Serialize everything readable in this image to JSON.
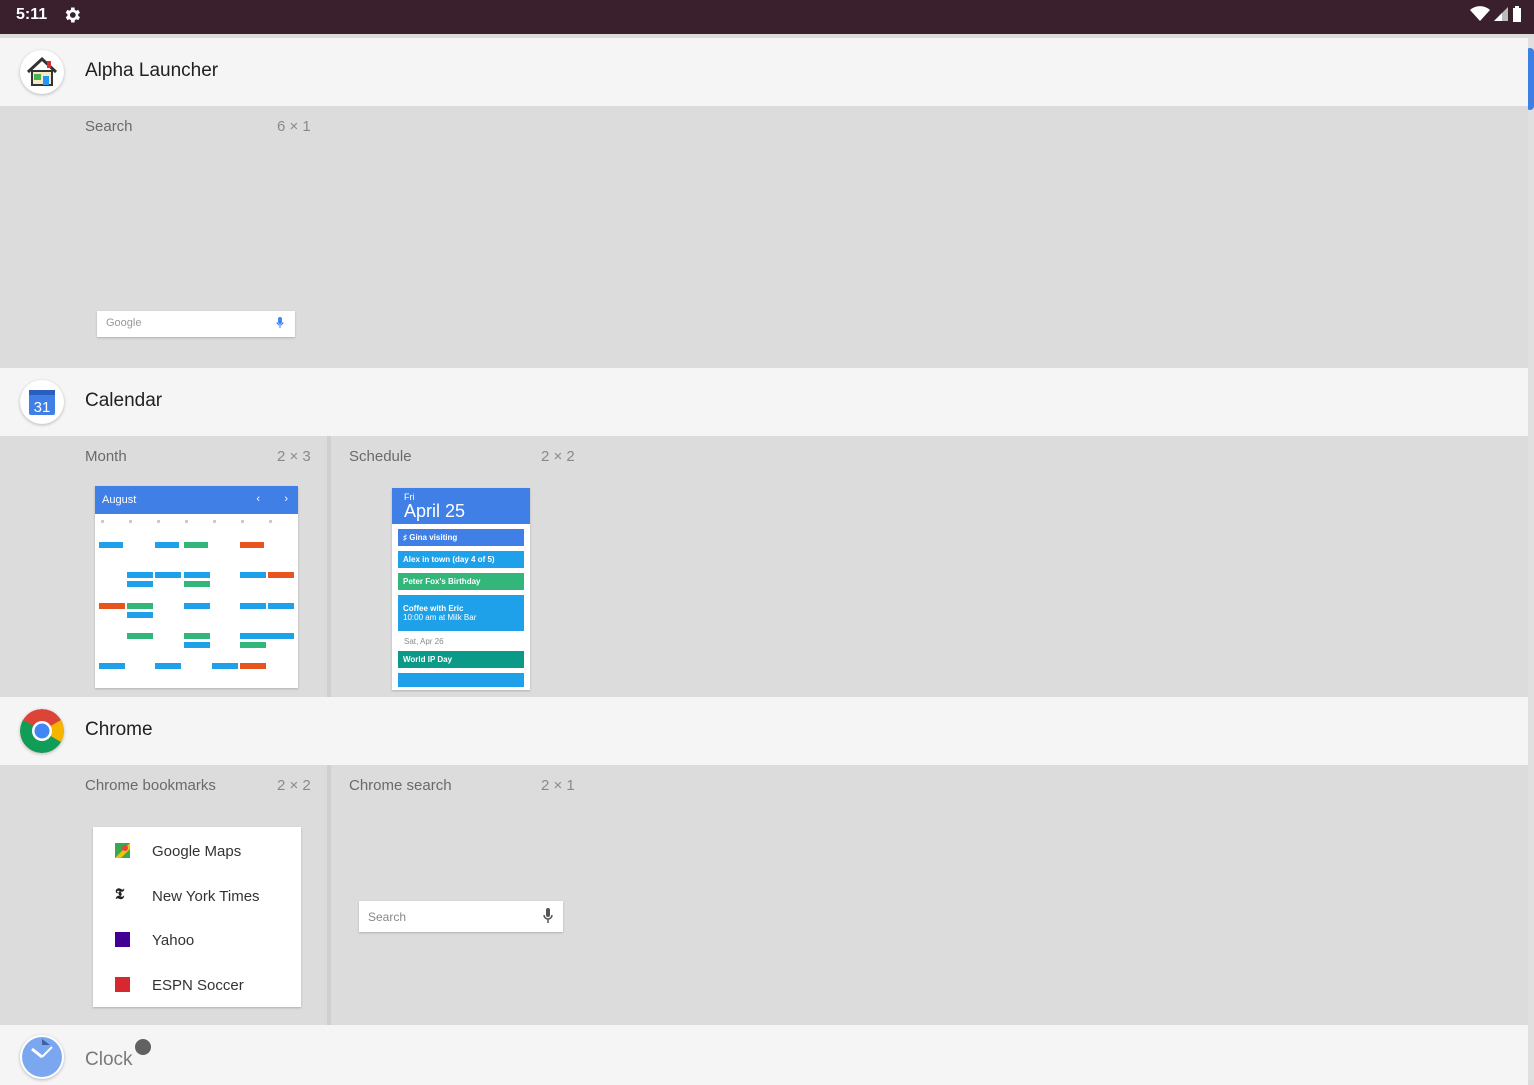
{
  "status_bar": {
    "time": "5:11"
  },
  "apps": [
    {
      "name": "Alpha Launcher",
      "widgets": [
        {
          "label": "Search",
          "size": "6 × 1",
          "preview_logo": "Google"
        }
      ]
    },
    {
      "name": "Calendar",
      "icon_text": "31",
      "widgets": [
        {
          "label": "Month",
          "size": "2 × 3",
          "month": "August"
        },
        {
          "label": "Schedule",
          "size": "2 × 2",
          "day": "Fri",
          "date": "April 25",
          "events": [
            {
              "text": "♯ Gina visiting",
              "color": "#3f7fe6"
            },
            {
              "text": "Alex in town (day 4 of 5)",
              "color": "#1ea1e8"
            },
            {
              "text": "Peter Fox's Birthday",
              "color": "#33b679"
            },
            {
              "text": "Coffee with Eric",
              "text2": "10:00 am at Milk Bar",
              "color": "#1ea1e8"
            }
          ],
          "next_day": "Sat, Apr 26",
          "next_events": [
            {
              "text": "World IP Day",
              "color": "#0b9a87"
            }
          ]
        }
      ]
    },
    {
      "name": "Chrome",
      "widgets": [
        {
          "label": "Chrome bookmarks",
          "size": "2 × 2",
          "bookmarks": [
            {
              "name": "Google Maps",
              "icon": "maps-icon",
              "color": "#34a853"
            },
            {
              "name": "New York Times",
              "icon": "nyt-icon",
              "color": "#222222"
            },
            {
              "name": "Yahoo",
              "icon": "yahoo-icon",
              "color": "#410093"
            },
            {
              "name": "ESPN Soccer",
              "icon": "espn-icon",
              "color": "#d7282f"
            }
          ]
        },
        {
          "label": "Chrome search",
          "size": "2 × 1",
          "placeholder": "Search"
        }
      ]
    },
    {
      "name": "Clock"
    }
  ],
  "colors": {
    "accent": "#3f7fe6",
    "status_bar": "#3a1f2c"
  }
}
